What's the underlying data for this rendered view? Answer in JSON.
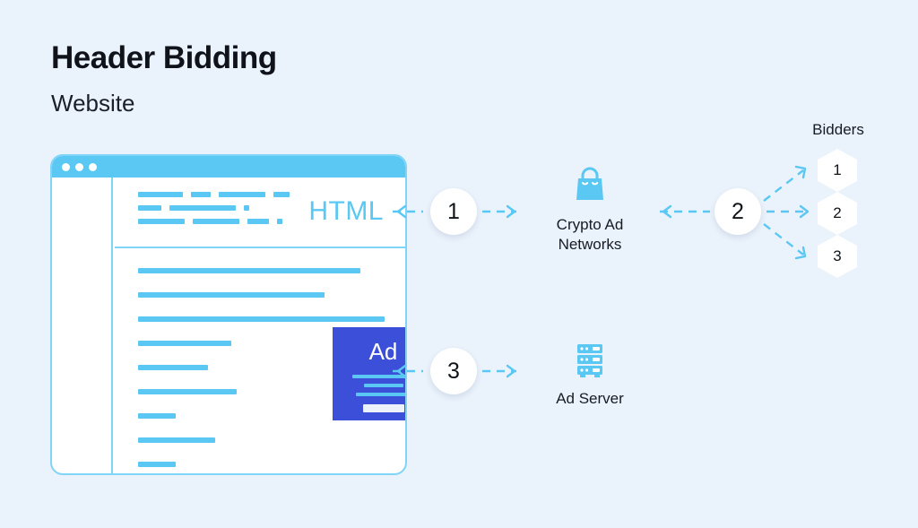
{
  "page": {
    "background_color": "#eaf2fb",
    "accent_blue": "#5ac8f2",
    "ad_blue": "#3b4fd8",
    "text_color": "#111418"
  },
  "header": {
    "title": "Header Bidding",
    "subtitle": "Website"
  },
  "browser": {
    "window_dots": [
      "dot-1",
      "dot-2",
      "dot-3"
    ],
    "html_label": "HTML",
    "code_rows": [
      [
        50,
        22,
        52,
        18
      ],
      [
        26,
        74,
        6
      ],
      [
        52,
        52,
        24,
        6
      ]
    ],
    "text_lines": [
      248,
      208,
      275,
      104,
      78,
      110,
      42,
      86,
      42,
      248,
      148
    ],
    "ad": {
      "label": "Ad",
      "lines": [
        70,
        44,
        62
      ],
      "button_label": ""
    }
  },
  "steps": [
    {
      "id": "step-1",
      "number": "1"
    },
    {
      "id": "step-2",
      "number": "2"
    },
    {
      "id": "step-3",
      "number": "3"
    }
  ],
  "nodes": {
    "crypto": {
      "label": "Crypto Ad\nNetworks",
      "label_line_1": "Crypto Ad",
      "label_line_2": "Networks",
      "icon": "shopping-bag-icon"
    },
    "server": {
      "label": "Ad Server",
      "icon": "server-rack-icon"
    }
  },
  "bidders": {
    "title": "Bidders",
    "items": [
      {
        "number": "1"
      },
      {
        "number": "2"
      },
      {
        "number": "3"
      }
    ]
  }
}
